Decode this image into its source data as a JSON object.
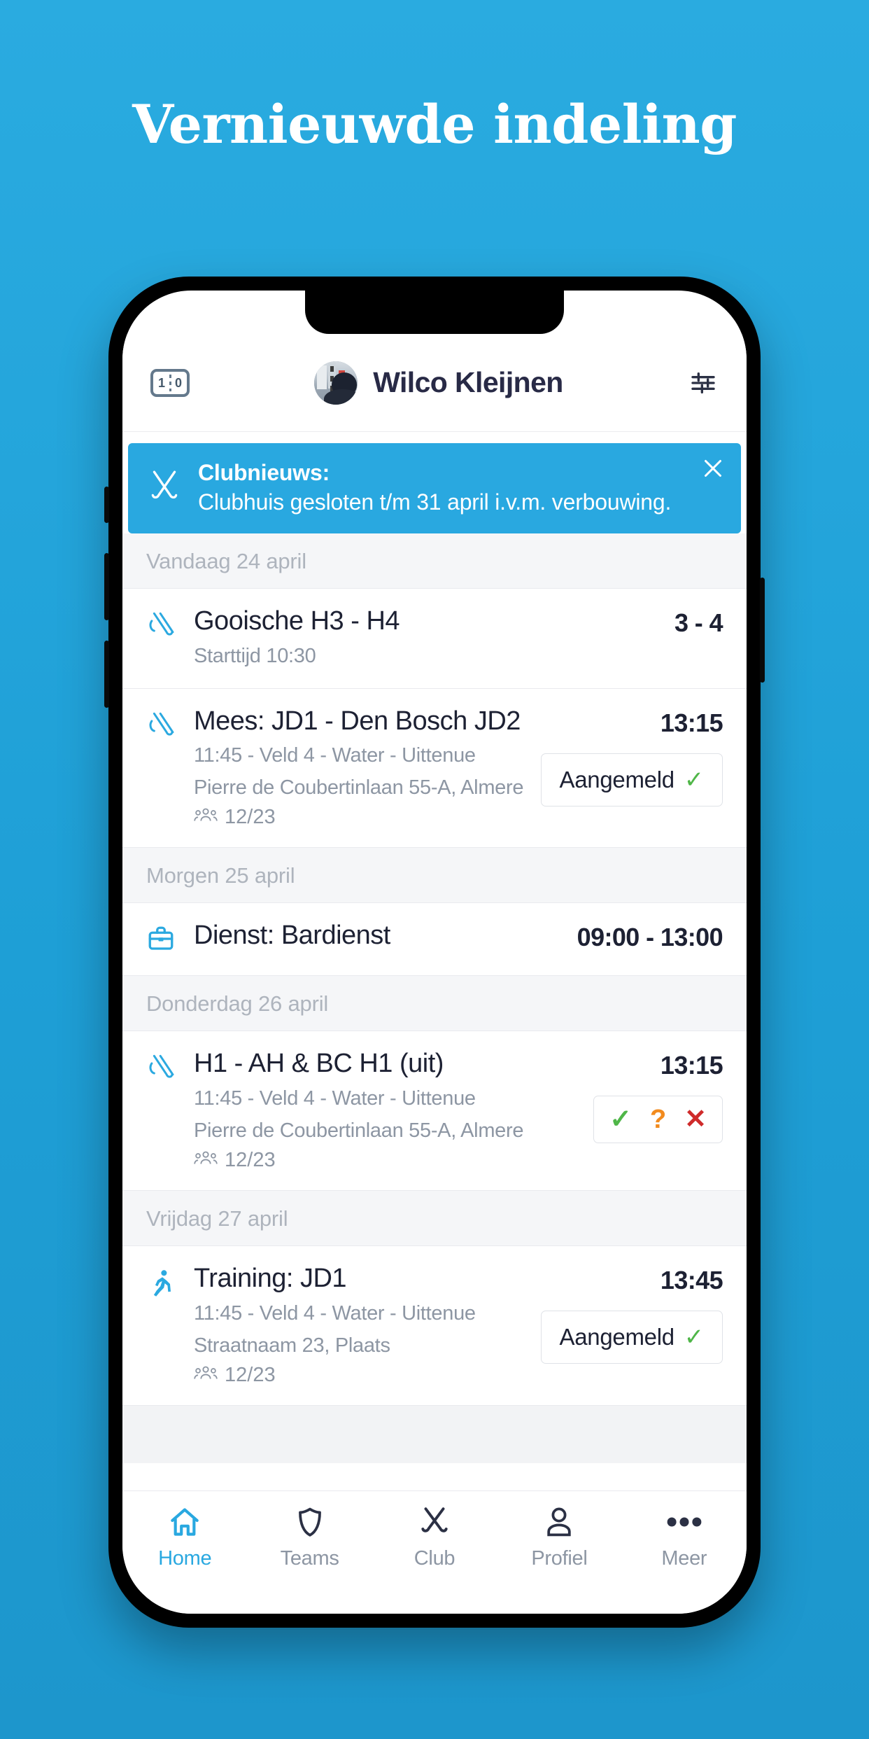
{
  "headline": "Vernieuwde indeling",
  "theme": {
    "background_blue": "#1fa3da",
    "accent_blue": "#29a8e0",
    "text_dark": "#1d2133",
    "text_muted": "#8d96a3",
    "green": "#4fb648",
    "orange": "#f28b1e",
    "red": "#cf2b2b"
  },
  "app": {
    "header": {
      "score_icon": {
        "name": "scoreboard-icon",
        "left_digit": "1",
        "right_digit": "0"
      },
      "user_name": "Wilco Kleijnen",
      "avatar_name": "user-avatar",
      "settings_icon": "sliders-icon"
    },
    "banner": {
      "icon": "crossed-sticks-icon",
      "title": "Clubnieuws:",
      "message": "Clubhuis gesloten t/m 31 april i.v.m. verbouwing.",
      "close_icon": "close-icon"
    },
    "days": [
      {
        "label": "Vandaag 24 april",
        "events": [
          {
            "icon": "hockey-sticks-icon",
            "title": "Gooische H3 - H4",
            "lines": [
              "Starttijd 10:30"
            ],
            "attendance": null,
            "time": "3 - 4",
            "action": null
          }
        ]
      },
      {
        "label": "",
        "events": [
          {
            "icon": "hockey-sticks-icon",
            "title": "Mees: JD1 - Den Bosch JD2",
            "lines": [
              "11:45 - Veld 4 - Water - Uittenue",
              "Pierre de Coubertinlaan 55-A, Almere"
            ],
            "attendance": "12/23",
            "time": "13:15",
            "action": {
              "type": "aangemeld",
              "label": "Aangemeld",
              "check": "✓"
            }
          }
        ]
      },
      {
        "label": "Morgen 25 april",
        "events": [
          {
            "icon": "briefcase-icon",
            "title": "Dienst: Bardienst",
            "lines": [],
            "attendance": null,
            "time": "09:00 - 13:00",
            "action": null
          }
        ]
      },
      {
        "label": "Donderdag 26 april",
        "events": [
          {
            "icon": "hockey-sticks-icon",
            "title": "H1 - AH & BC H1 (uit)",
            "lines": [
              "11:45 - Veld 4 - Water - Uittenue",
              "Pierre de Coubertinlaan 55-A, Almere"
            ],
            "attendance": "12/23",
            "time": "13:15",
            "action": {
              "type": "triple",
              "yes": "✓",
              "maybe": "?",
              "no": "✕"
            }
          }
        ]
      },
      {
        "label": "Vrijdag 27 april",
        "events": [
          {
            "icon": "running-icon",
            "title": "Training: JD1",
            "lines": [
              "11:45 - Veld 4 - Water - Uittenue",
              "Straatnaam 23, Plaats"
            ],
            "attendance": "12/23",
            "time": "13:45",
            "action": {
              "type": "aangemeld",
              "label": "Aangemeld",
              "check": "✓"
            }
          }
        ]
      }
    ],
    "tabs": [
      {
        "label": "Home",
        "icon": "home-icon",
        "active": true
      },
      {
        "label": "Teams",
        "icon": "shield-icon",
        "active": false
      },
      {
        "label": "Club",
        "icon": "crossed-sticks-icon",
        "active": false
      },
      {
        "label": "Profiel",
        "icon": "person-icon",
        "active": false
      },
      {
        "label": "Meer",
        "icon": "ellipsis-icon",
        "active": false
      }
    ]
  }
}
